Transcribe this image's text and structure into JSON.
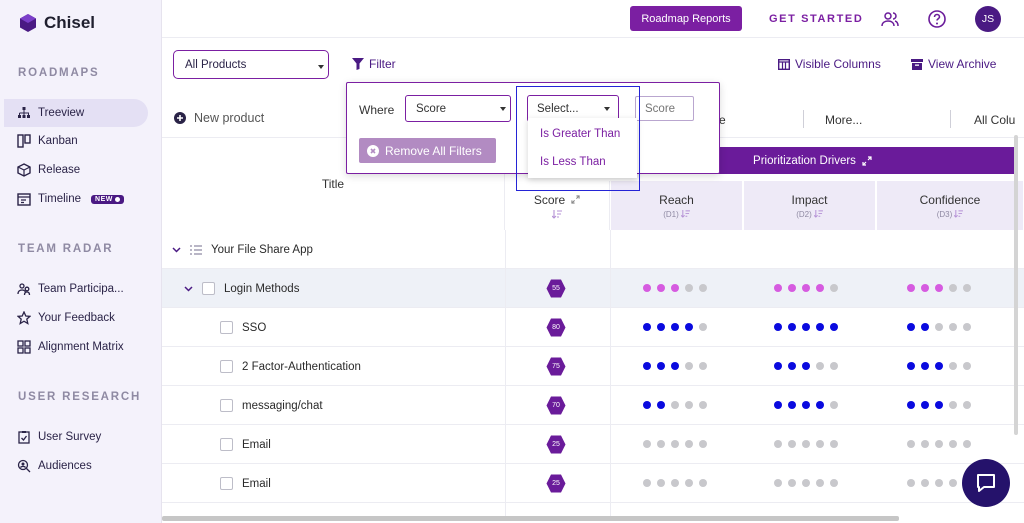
{
  "brand": {
    "name": "Chisel"
  },
  "sidebar": {
    "sections": [
      {
        "label": "ROADMAPS",
        "items": [
          {
            "label": "Treeview",
            "active": true,
            "icon": "treeview-icon"
          },
          {
            "label": "Kanban",
            "icon": "kanban-icon"
          },
          {
            "label": "Release",
            "icon": "release-icon"
          },
          {
            "label": "Timeline",
            "icon": "timeline-icon",
            "badge": "NEW"
          }
        ]
      },
      {
        "label": "TEAM RADAR",
        "items": [
          {
            "label": "Team Participa...",
            "icon": "team-icon"
          },
          {
            "label": "Your Feedback",
            "icon": "star-icon"
          },
          {
            "label": "Alignment Matrix",
            "icon": "grid-icon"
          }
        ]
      },
      {
        "label": "USER RESEARCH",
        "items": [
          {
            "label": "User Survey",
            "icon": "clipboard-icon"
          },
          {
            "label": "Audiences",
            "icon": "search-user-icon"
          }
        ]
      }
    ]
  },
  "topbar": {
    "reports_label": "Roadmap Reports",
    "get_started": "GET STARTED",
    "avatar_initials": "JS"
  },
  "toolbar": {
    "product_select": "All Products",
    "filter_label": "Filter",
    "visible_columns": "Visible Columns",
    "view_archive": "View Archive"
  },
  "subbar": {
    "new_product": "New product",
    "tabs": [
      "e",
      "More...",
      "All Colu"
    ]
  },
  "filter": {
    "where_label": "Where",
    "field_value": "Score",
    "operator_placeholder": "Select...",
    "value_placeholder": "Score",
    "remove_all": "Remove All Filters",
    "operator_options": [
      "Is Greater Than",
      "Is Less Than"
    ]
  },
  "table": {
    "title_header": "Title",
    "group_header": "Prioritization Drivers",
    "columns": [
      {
        "label": "Score",
        "sub": ""
      },
      {
        "label": "Reach",
        "sub": "(D1)"
      },
      {
        "label": "Impact",
        "sub": "(D2)"
      },
      {
        "label": "Confidence",
        "sub": "(D3)"
      }
    ],
    "rows": [
      {
        "title": "Your File Share App",
        "level": 0,
        "type": "product",
        "score": null
      },
      {
        "title": "Login Methods",
        "level": 1,
        "type": "group",
        "score": "55",
        "reach": 3,
        "impact": 4,
        "confidence": 3,
        "color": "pink"
      },
      {
        "title": "SSO",
        "level": 2,
        "score": "80",
        "reach": 4,
        "impact": 5,
        "confidence": 2,
        "color": "blue"
      },
      {
        "title": "2 Factor-Authentication",
        "level": 2,
        "score": "75",
        "reach": 3,
        "impact": 3,
        "confidence": 3,
        "color": "blue"
      },
      {
        "title": "messaging/chat",
        "level": 2,
        "score": "70",
        "reach": 2,
        "impact": 4,
        "confidence": 3,
        "color": "blue"
      },
      {
        "title": "Email",
        "level": 2,
        "score": "25",
        "reach": 0,
        "impact": 0,
        "confidence": 0,
        "color": "blue"
      },
      {
        "title": "Email",
        "level": 2,
        "score": "25",
        "reach": 0,
        "impact": 0,
        "confidence": 0,
        "color": "blue"
      }
    ]
  },
  "colors": {
    "accent": "#7b1fa2",
    "dark": "#4a1a83",
    "blue_dot": "#0a0adf",
    "pink_dot": "#d65be0"
  }
}
